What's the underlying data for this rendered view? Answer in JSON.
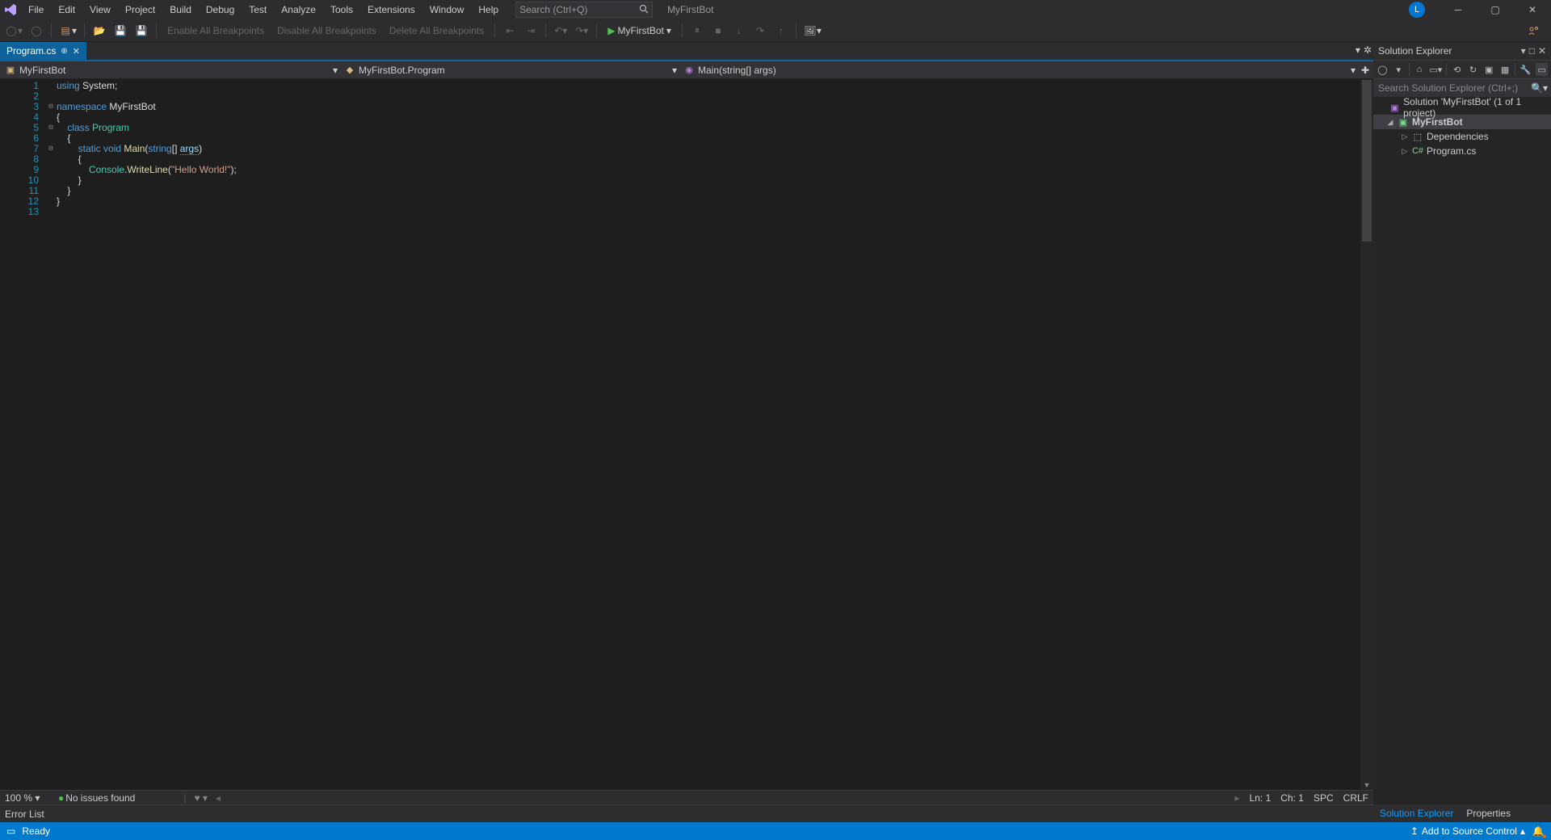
{
  "menu": {
    "items": [
      "File",
      "Edit",
      "View",
      "Project",
      "Build",
      "Debug",
      "Test",
      "Analyze",
      "Tools",
      "Extensions",
      "Window",
      "Help"
    ]
  },
  "search": {
    "placeholder": "Search (Ctrl+Q)"
  },
  "app_title": "MyFirstBot",
  "avatar_letter": "L",
  "toolbar": {
    "enable_bp": "Enable All Breakpoints",
    "disable_bp": "Disable All Breakpoints",
    "delete_bp": "Delete All Breakpoints",
    "start_target": "MyFirstBot"
  },
  "tab": {
    "name": "Program.cs"
  },
  "nav": {
    "project": "MyFirstBot",
    "class": "MyFirstBot.Program",
    "member": "Main(string[] args)"
  },
  "code": {
    "line_count": 13,
    "lines": [
      {
        "segs": [
          {
            "t": "using ",
            "c": "kw"
          },
          {
            "t": "System",
            "c": "plain"
          },
          {
            "t": ";",
            "c": "plain"
          }
        ]
      },
      {
        "segs": []
      },
      {
        "segs": [
          {
            "t": "namespace ",
            "c": "kw"
          },
          {
            "t": "MyFirstBot",
            "c": "plain"
          }
        ]
      },
      {
        "segs": [
          {
            "t": "{",
            "c": "plain"
          }
        ]
      },
      {
        "segs": [
          {
            "t": "    ",
            "c": "plain"
          },
          {
            "t": "class ",
            "c": "kw"
          },
          {
            "t": "Program",
            "c": "cls"
          }
        ]
      },
      {
        "segs": [
          {
            "t": "    {",
            "c": "plain"
          }
        ]
      },
      {
        "segs": [
          {
            "t": "        ",
            "c": "plain"
          },
          {
            "t": "static ",
            "c": "kw"
          },
          {
            "t": "void ",
            "c": "kw"
          },
          {
            "t": "Main",
            "c": "fn"
          },
          {
            "t": "(",
            "c": "plain"
          },
          {
            "t": "string",
            "c": "kw"
          },
          {
            "t": "[] ",
            "c": "plain"
          },
          {
            "t": "args",
            "c": "dimparam"
          },
          {
            "t": ")",
            "c": "plain"
          }
        ]
      },
      {
        "segs": [
          {
            "t": "        {",
            "c": "plain"
          }
        ]
      },
      {
        "segs": [
          {
            "t": "            ",
            "c": "plain"
          },
          {
            "t": "Console",
            "c": "cls"
          },
          {
            "t": ".",
            "c": "plain"
          },
          {
            "t": "WriteLine",
            "c": "fn"
          },
          {
            "t": "(",
            "c": "plain"
          },
          {
            "t": "\"Hello World!\"",
            "c": "str"
          },
          {
            "t": ");",
            "c": "plain"
          }
        ]
      },
      {
        "segs": [
          {
            "t": "        }",
            "c": "plain"
          }
        ]
      },
      {
        "segs": [
          {
            "t": "    }",
            "c": "plain"
          }
        ]
      },
      {
        "segs": [
          {
            "t": "}",
            "c": "plain"
          }
        ]
      },
      {
        "segs": []
      }
    ],
    "fold_marks": {
      "1": "",
      "3": "⊟",
      "5": "⊟",
      "7": "⊟"
    }
  },
  "editor_bottom": {
    "zoom": "100 %",
    "issues": "No issues found",
    "ln": "Ln: 1",
    "ch": "Ch: 1",
    "spc": "SPC",
    "crlf": "CRLF"
  },
  "error_list_label": "Error List",
  "sx": {
    "title": "Solution Explorer",
    "search_placeholder": "Search Solution Explorer (Ctrl+;)",
    "solution": "Solution 'MyFirstBot' (1 of 1 project)",
    "project": "MyFirstBot",
    "deps": "Dependencies",
    "file": "Program.cs",
    "tab_active": "Solution Explorer",
    "tab_other": "Properties"
  },
  "status": {
    "ready": "Ready",
    "add_source": "Add to Source Control"
  }
}
